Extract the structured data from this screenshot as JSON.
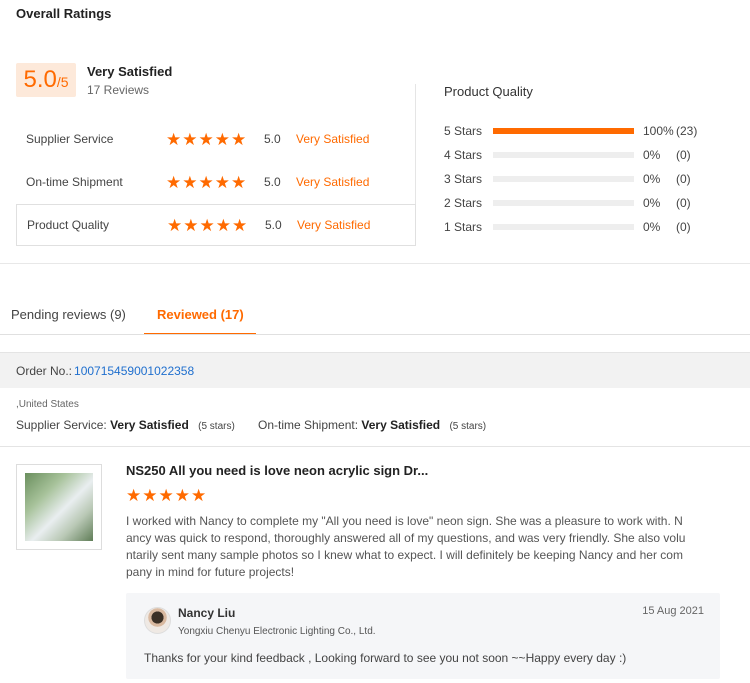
{
  "overall": {
    "title": "Overall Ratings",
    "score": "5.0",
    "score_suffix": "/5",
    "label": "Very Satisfied",
    "reviews": "17 Reviews"
  },
  "ratings": [
    {
      "label": "Supplier Service",
      "stars": 5,
      "value": "5.0",
      "desc": "Very Satisfied"
    },
    {
      "label": "On-time Shipment",
      "stars": 5,
      "value": "5.0",
      "desc": "Very Satisfied"
    },
    {
      "label": "Product Quality",
      "stars": 5,
      "value": "5.0",
      "desc": "Very Satisfied"
    }
  ],
  "product_quality": {
    "title": "Product Quality",
    "rows": [
      {
        "label": "5 Stars",
        "fraction": 1.0,
        "pct": "100%",
        "count": "(23)"
      },
      {
        "label": "4 Stars",
        "fraction": 0,
        "pct": "0%",
        "count": "(0)"
      },
      {
        "label": "3 Stars",
        "fraction": 0,
        "pct": "0%",
        "count": "(0)"
      },
      {
        "label": "2 Stars",
        "fraction": 0,
        "pct": "0%",
        "count": "(0)"
      },
      {
        "label": "1 Stars",
        "fraction": 0,
        "pct": "0%",
        "count": "(0)"
      }
    ]
  },
  "tabs": {
    "pending": "Pending reviews (9)",
    "reviewed": "Reviewed (17)"
  },
  "order": {
    "label": "Order No.:",
    "number": "100715459001022358"
  },
  "review": {
    "country": ",United States",
    "supplier_label": "Supplier Service:",
    "supplier_value": "Very Satisfied",
    "supplier_stars": "(5 stars)",
    "shipment_label": "On-time Shipment:",
    "shipment_value": "Very Satisfied",
    "shipment_stars": "(5 stars)",
    "product_title": "NS250 All you need is love neon acrylic sign Dr...",
    "stars": 5,
    "text": "I worked with Nancy to complete my \"All you need is love\" neon sign. She was a pleasure to work with. Nancy was quick to respond, thoroughly answered all of my questions, and was very friendly. She also voluntarily sent many sample photos so I knew what to expect. I will definitely be keeping Nancy and her company in mind for future projects!"
  },
  "reply": {
    "name": "Nancy Liu",
    "company": "Yongxiu Chenyu Electronic Lighting Co., Ltd.",
    "date": "15 Aug 2021",
    "text": "Thanks for your kind feedback , Looking forward to see you not soon ~~Happy every day :)"
  },
  "colors": {
    "accent": "#ff6a00",
    "link": "#1f6fce"
  },
  "icons": {
    "star": "star-icon"
  }
}
